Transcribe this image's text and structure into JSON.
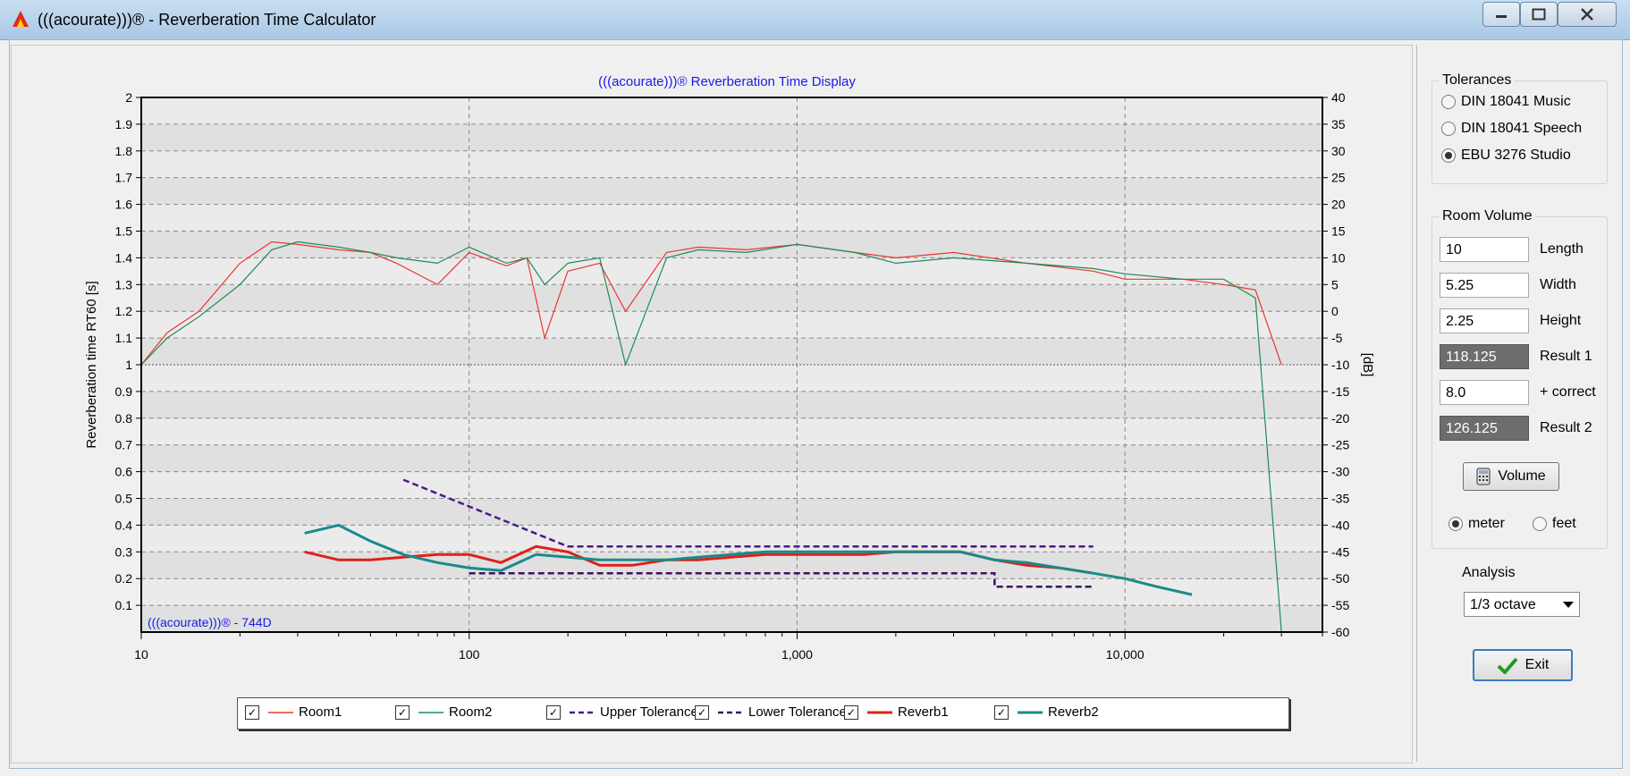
{
  "window": {
    "title": "(((acourate)))® - Reverberation Time Calculator"
  },
  "chart_data": {
    "type": "line",
    "title": "(((acourate)))® Reverberation Time Display",
    "watermark": "(((acourate)))® - 744D",
    "ylabel": "Reverberation time RT60 [s]",
    "y2label": "[dB]",
    "xscale": "log",
    "xlim": [
      10,
      40000
    ],
    "ylim": [
      0,
      2
    ],
    "y2lim": [
      -60,
      40
    ],
    "xticks": [
      "10",
      "100",
      "1,000",
      "10,000"
    ],
    "yticks": [
      "2",
      "1.9",
      "1.8",
      "1.7",
      "1.6",
      "1.5",
      "1.4",
      "1.3",
      "1.2",
      "1.1",
      "1",
      "0.9",
      "0.8",
      "0.7",
      "0.6",
      "0.5",
      "0.4",
      "0.3",
      "0.2",
      "0.1"
    ],
    "y2ticks": [
      "40",
      "35",
      "30",
      "25",
      "20",
      "15",
      "10",
      "5",
      "0",
      "-5",
      "-10",
      "-15",
      "-20",
      "-25",
      "-30",
      "-35",
      "-40",
      "-45",
      "-50",
      "-55",
      "-60"
    ],
    "grid": true,
    "legend_position": "bottom",
    "series": [
      {
        "name": "Room1",
        "color": "#e8392f",
        "style": "thin",
        "x": [
          10,
          12,
          15,
          20,
          25,
          30,
          40,
          50,
          60,
          80,
          100,
          130,
          150,
          170,
          200,
          250,
          300,
          400,
          500,
          700,
          1000,
          1500,
          2000,
          3000,
          5000,
          8000,
          10000,
          15000,
          20000,
          25000,
          30000
        ],
        "y": [
          1.0,
          1.12,
          1.2,
          1.38,
          1.46,
          1.45,
          1.43,
          1.42,
          1.38,
          1.3,
          1.42,
          1.37,
          1.4,
          1.1,
          1.35,
          1.38,
          1.2,
          1.42,
          1.44,
          1.43,
          1.45,
          1.42,
          1.4,
          1.42,
          1.38,
          1.35,
          1.32,
          1.32,
          1.3,
          1.28,
          1.0
        ]
      },
      {
        "name": "Room2",
        "color": "#1e8a5a",
        "style": "thin",
        "x": [
          10,
          12,
          15,
          20,
          25,
          30,
          40,
          50,
          60,
          80,
          100,
          130,
          150,
          170,
          200,
          250,
          300,
          400,
          500,
          700,
          1000,
          1500,
          2000,
          3000,
          5000,
          8000,
          10000,
          15000,
          20000,
          25000,
          30000
        ],
        "y": [
          1.0,
          1.1,
          1.18,
          1.3,
          1.43,
          1.46,
          1.44,
          1.42,
          1.4,
          1.38,
          1.44,
          1.38,
          1.4,
          1.3,
          1.38,
          1.4,
          1.0,
          1.4,
          1.43,
          1.42,
          1.45,
          1.42,
          1.38,
          1.4,
          1.38,
          1.36,
          1.34,
          1.32,
          1.32,
          1.25,
          0.0
        ]
      },
      {
        "name": "Upper Tolerance",
        "color": "#4b1a8a",
        "style": "dashed",
        "x": [
          63,
          100,
          200,
          400,
          800,
          8000
        ],
        "y": [
          0.57,
          0.47,
          0.32,
          0.32,
          0.32,
          0.32
        ]
      },
      {
        "name": "Lower Tolerance",
        "color": "#3d1260",
        "style": "dashed",
        "x": [
          100,
          125,
          200,
          400,
          1000,
          4000,
          4000,
          8000
        ],
        "y": [
          0.22,
          0.22,
          0.22,
          0.22,
          0.22,
          0.22,
          0.17,
          0.17
        ]
      },
      {
        "name": "Reverb1",
        "color": "#e0201a",
        "style": "thick",
        "x": [
          31.5,
          40,
          50,
          63,
          80,
          100,
          125,
          160,
          200,
          250,
          315,
          400,
          500,
          630,
          800,
          1000,
          1250,
          1600,
          2000,
          2500,
          3150,
          4000,
          5000,
          6300,
          8000
        ],
        "y": [
          0.3,
          0.27,
          0.27,
          0.28,
          0.29,
          0.29,
          0.26,
          0.32,
          0.3,
          0.25,
          0.25,
          0.27,
          0.27,
          0.28,
          0.29,
          0.29,
          0.29,
          0.29,
          0.3,
          0.3,
          0.3,
          0.27,
          0.25,
          0.24,
          0.22
        ]
      },
      {
        "name": "Reverb2",
        "color": "#1a8a8a",
        "style": "thick",
        "x": [
          31.5,
          40,
          50,
          63,
          80,
          100,
          125,
          160,
          200,
          250,
          315,
          400,
          500,
          630,
          800,
          1000,
          1250,
          1600,
          2000,
          2500,
          3150,
          4000,
          5000,
          6300,
          8000,
          10000,
          12500,
          16000
        ],
        "y": [
          0.37,
          0.4,
          0.34,
          0.29,
          0.26,
          0.24,
          0.23,
          0.29,
          0.28,
          0.27,
          0.27,
          0.27,
          0.28,
          0.29,
          0.3,
          0.3,
          0.3,
          0.3,
          0.3,
          0.3,
          0.3,
          0.27,
          0.26,
          0.24,
          0.22,
          0.2,
          0.17,
          0.14
        ]
      }
    ]
  },
  "legend": {
    "items": [
      {
        "label": "Room1",
        "checked": true,
        "color": "#e8392f",
        "style": "thin"
      },
      {
        "label": "Room2",
        "checked": true,
        "color": "#1e8a5a",
        "style": "thin"
      },
      {
        "label": "Upper Tolerance",
        "checked": true,
        "color": "#4b1a8a",
        "style": "dashed"
      },
      {
        "label": "Lower Tolerance",
        "checked": true,
        "color": "#3d1260",
        "style": "dashed"
      },
      {
        "label": "Reverb1",
        "checked": true,
        "color": "#e0201a",
        "style": "thick"
      },
      {
        "label": "Reverb2",
        "checked": true,
        "color": "#1a8a8a",
        "style": "thick"
      }
    ]
  },
  "tolerances": {
    "title": "Tolerances",
    "options": [
      {
        "label": "DIN 18041 Music",
        "selected": false
      },
      {
        "label": "DIN 18041 Speech",
        "selected": false
      },
      {
        "label": "EBU 3276 Studio",
        "selected": true
      }
    ]
  },
  "room_volume": {
    "title": "Room Volume",
    "length": {
      "value": "10",
      "label": "Length"
    },
    "width": {
      "value": "5.25",
      "label": "Width"
    },
    "height": {
      "value": "2.25",
      "label": "Height"
    },
    "result1": {
      "value": "118.125",
      "label": "Result 1"
    },
    "correct": {
      "value": "8.0",
      "label": "+ correct"
    },
    "result2": {
      "value": "126.125",
      "label": "Result 2"
    },
    "volume_button": "Volume",
    "units": [
      {
        "label": "meter",
        "selected": true
      },
      {
        "label": "feet",
        "selected": false
      }
    ]
  },
  "analysis": {
    "label": "Analysis",
    "value": "1/3 octave"
  },
  "exit_button": "Exit"
}
